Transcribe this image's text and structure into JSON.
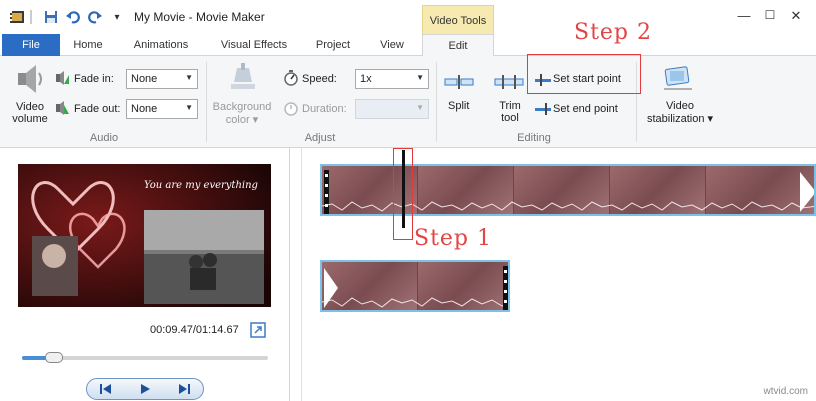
{
  "title": "My Movie - Movie Maker",
  "context_tab": "Video Tools",
  "tabs": [
    "File",
    "Home",
    "Animations",
    "Visual Effects",
    "Project",
    "View",
    "Edit"
  ],
  "audio": {
    "volume_line1": "Video",
    "volume_line2": "volume",
    "fade_in_label": "Fade in:",
    "fade_in_value": "None",
    "fade_out_label": "Fade out:",
    "fade_out_value": "None",
    "group": "Audio"
  },
  "adjust": {
    "bg_line1": "Background",
    "bg_line2": "color",
    "speed_label": "Speed:",
    "speed_value": "1x",
    "duration_label": "Duration:",
    "group": "Adjust"
  },
  "editing": {
    "split": "Split",
    "trim_line1": "Trim",
    "trim_line2": "tool",
    "set_start": "Set start point",
    "set_end": "Set end point",
    "group": "Editing"
  },
  "stabilization": {
    "line1": "Video",
    "line2": "stabilization"
  },
  "annotations": {
    "step1": "Step 1",
    "step2": "Step 2"
  },
  "preview": {
    "caption": "You are my everything",
    "time": "00:09.47/01:14.67"
  },
  "playback": {
    "progress_fraction": 0.13
  },
  "watermark": "wtvid.com",
  "colors": {
    "file_tab": "#2b6cc4",
    "context_tab": "#f7eab0",
    "clip_border": "#7cc2e6",
    "annotation": "#e23b3b"
  }
}
